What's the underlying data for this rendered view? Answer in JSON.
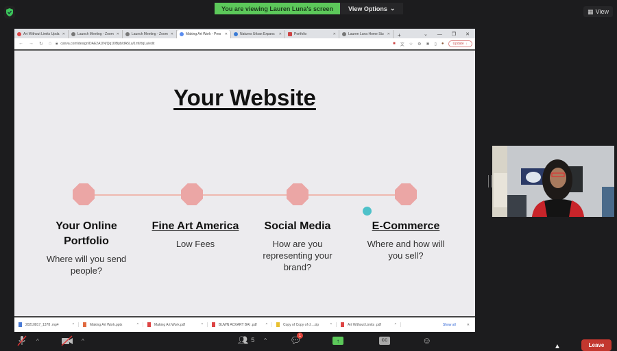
{
  "zoom_top": {
    "banner_message": "You are viewing Lauren Luna's screen",
    "view_options_label": "View Options",
    "view_label": "View"
  },
  "browser": {
    "tabs": [
      {
        "label": "Art Without Limits Upda",
        "icon": "gmail-icon",
        "active": false
      },
      {
        "label": "Launch Meeting - Zoom",
        "icon": "globe-icon",
        "active": false
      },
      {
        "label": "Launch Meeting - Zoom",
        "icon": "globe-icon",
        "active": false
      },
      {
        "label": "Making Art Work - Pres",
        "icon": "canva-icon",
        "active": true
      },
      {
        "label": "Natures Urban Expans",
        "icon": "app-icon",
        "active": false
      },
      {
        "label": "Portfolio",
        "icon": "pdf-icon",
        "active": false
      },
      {
        "label": "Lauren Luna Home Stu",
        "icon": "person-icon",
        "active": false
      }
    ],
    "url": "canva.com/design/DAE2A1IN/Qq1l0Bpb/dA5La/1mf/dqLa/edit",
    "update_label": "Update"
  },
  "slide": {
    "title": "Your Website",
    "columns": [
      {
        "heading": "Your Online Portfolio",
        "text": "Where will you send people?",
        "underlined": false
      },
      {
        "heading": "Fine Art America",
        "text": "Low Fees",
        "underlined": true
      },
      {
        "heading": "Social Media",
        "text": "How are you representing your brand?",
        "underlined": false
      },
      {
        "heading": "E-Commerce",
        "text": "Where and how will you sell?",
        "underlined": true
      }
    ],
    "accent_color": "#eba6a5"
  },
  "downloads": {
    "items": [
      {
        "name": "20210817_1378 .mp4"
      },
      {
        "name": "Making Art Work.pptx"
      },
      {
        "name": "Making Art Work.pdf"
      },
      {
        "name": "BUWN ACKART BAI .pdf"
      },
      {
        "name": "Copy of Copy of d ...zip"
      },
      {
        "name": "Art Without Limits .pdf"
      }
    ],
    "show_all_label": "Show all"
  },
  "toolbar": {
    "participants_count": "5",
    "chat_badge": "1",
    "cc_label": "CC",
    "leave_label": "Leave"
  }
}
